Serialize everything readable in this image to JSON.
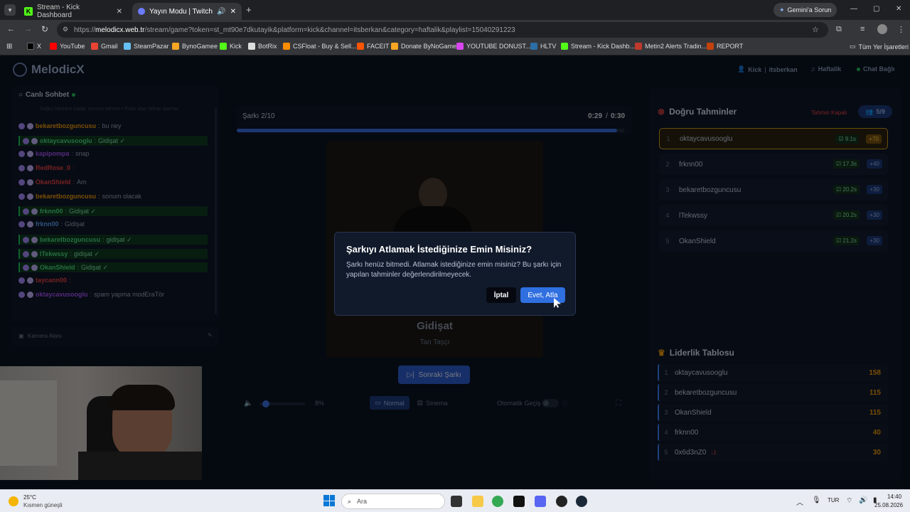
{
  "browser": {
    "tabs": [
      {
        "title": "Stream - Kick Dashboard"
      },
      {
        "title": "Yayın Modu | Twitch ve Kick"
      }
    ],
    "profile_button": "Gemini'a Sorun",
    "url_prefix": "https://",
    "url_host": "melodicx.web.tr",
    "url_path": "/stream/game?token=st_mt90e7dkutayik&platform=kick&channel=itsberkan&category=haftalik&playlist=15040291223",
    "bookmarks": [
      "X",
      "YouTube",
      "Gmail",
      "SteamPazar",
      "BynoGamee",
      "Kick",
      "BotRix",
      "CSFloat - Buy & Sell...",
      "FACEIT",
      "Donate ByNoGame",
      "YOUTUBE DONUST...",
      "HLTV",
      "Stream - Kick Dashb...",
      "Metin2 Alerts Tradin...",
      "REPORT"
    ],
    "all_bookmarks": "Tüm Yer İşaretleri"
  },
  "app": {
    "logo": "MelodicX",
    "header": {
      "platform": "Kick",
      "channel": "itsberkan",
      "category": "Haftalik",
      "status": "Chat Bağlı"
    },
    "chat": {
      "title": "Canlı Sohbet",
      "hint": "Doğru tahmine kadar sınırsız tahmin • Puan alan tekrar alamaz",
      "messages": [
        {
          "user": "bekaretbozguncusu",
          "text": "bu ney",
          "hl": false,
          "color": "#f59e0b"
        },
        {
          "user": "oktaycavusooglu",
          "text": "Gidişat ✓",
          "hl": true,
          "color": "#4ade80"
        },
        {
          "user": "kapipompa",
          "text": "snap",
          "hl": false,
          "color": "#a855f7"
        },
        {
          "user": "RedRose_0",
          "text": "",
          "hl": false,
          "color": "#ef4444"
        },
        {
          "user": "OkanShield",
          "text": "Am",
          "hl": false,
          "color": "#ef4444"
        },
        {
          "user": "bekaretbozguncusu",
          "text": "sonum olacak",
          "hl": false,
          "color": "#f59e0b"
        },
        {
          "user": "frknn00",
          "text": "Gidişat ✓",
          "hl": true,
          "color": "#4ade80"
        },
        {
          "user": "frknn00",
          "text": "Gidişat",
          "hl": false,
          "color": "#60a5fa"
        },
        {
          "user": "bekaretbozguncusu",
          "text": "gidişat ✓",
          "hl": true,
          "color": "#4ade80"
        },
        {
          "user": "lTekwssy",
          "text": "gidişat ✓",
          "hl": true,
          "color": "#4ade80"
        },
        {
          "user": "OkanShield",
          "text": "Gidişat ✓",
          "hl": true,
          "color": "#4ade80"
        },
        {
          "user": "taycann00",
          "text": "",
          "hl": false,
          "color": "#ef4444"
        },
        {
          "user": "oktaycavusooglu",
          "text": "spam yapma modEraTör",
          "hl": false,
          "color": "#a855f7"
        }
      ]
    },
    "camera_label": "Kamera Alanı",
    "player": {
      "track_label": "Şarkı 2/10",
      "time_current": "0:29",
      "time_sep": "/",
      "time_total": "0:30",
      "progress": 0.98,
      "song_title": "Gidişat",
      "song_artist": "Tan Taşçı",
      "next_button": "Sonraki Şarkı",
      "volume": "8%",
      "mode_normal": "Normal",
      "mode_cinema": "Sinema",
      "auto_label": "Otomatik Geçiş"
    },
    "guesses": {
      "title": "Doğru Tahminler",
      "status": "Tahmin Kapalı",
      "count": "5/9",
      "rows": [
        {
          "rank": "1",
          "user": "oktaycavusooglu",
          "time": "9.1s",
          "points": "+70"
        },
        {
          "rank": "2",
          "user": "frknn00",
          "time": "17.3s",
          "points": "+40"
        },
        {
          "rank": "3",
          "user": "bekaretbozguncusu",
          "time": "20.2s",
          "points": "+30"
        },
        {
          "rank": "4",
          "user": "lTekwssy",
          "time": "20.2s",
          "points": "+30"
        },
        {
          "rank": "5",
          "user": "OkanShield",
          "time": "21.2s",
          "points": "+30"
        }
      ]
    },
    "leaderboard": {
      "title": "Liderlik Tablosu",
      "rows": [
        {
          "rank": "1",
          "user": "oktaycavusooglu",
          "points": "158",
          "delta": ""
        },
        {
          "rank": "2",
          "user": "bekaretbozguncusu",
          "points": "115",
          "delta": ""
        },
        {
          "rank": "3",
          "user": "OkanShield",
          "points": "115",
          "delta": ""
        },
        {
          "rank": "4",
          "user": "frknn00",
          "points": "40",
          "delta": ""
        },
        {
          "rank": "5",
          "user": "0x6d3nZ0",
          "points": "30",
          "delta": "↓1"
        }
      ]
    }
  },
  "modal": {
    "title": "Şarkıyı Atlamak İstediğinize Emin Misiniz?",
    "body": "Şarkı henüz bitmedi. Atlamak istediğinize emin misiniz? Bu şarkı için yapılan tahminler değerlendirilmeyecek.",
    "cancel": "İptal",
    "confirm": "Evet, Atla"
  },
  "taskbar": {
    "weather_temp": "25°C",
    "weather_desc": "Kısmen güneşli",
    "search": "Ara",
    "lang": "TUR",
    "time": "14:40",
    "date": "25.08.2026"
  }
}
